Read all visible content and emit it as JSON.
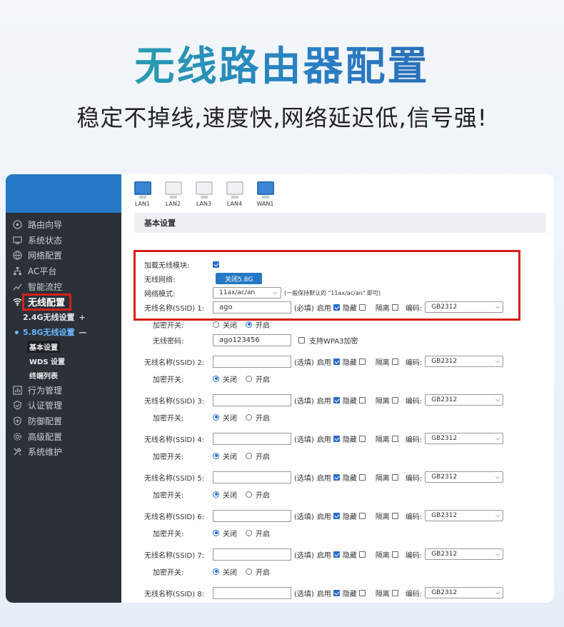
{
  "hero": {
    "title": "无线路由器配置",
    "subtitle": "稳定不掉线,速度快,网络延迟低,信号强!"
  },
  "ports": [
    {
      "label": "LAN1",
      "active": true
    },
    {
      "label": "LAN2",
      "active": false
    },
    {
      "label": "LAN3",
      "active": false
    },
    {
      "label": "LAN4",
      "active": false
    },
    {
      "label": "WAN1",
      "active": true
    }
  ],
  "sidebar": {
    "items_top": [
      {
        "label": "路由向导",
        "icon": "compass-icon"
      },
      {
        "label": "系统状态",
        "icon": "monitor-icon"
      },
      {
        "label": "网络配置",
        "icon": "globe-icon"
      },
      {
        "label": "AC平台",
        "icon": "network-tree-icon"
      },
      {
        "label": "智能流控",
        "icon": "trend-icon"
      }
    ],
    "active": {
      "label": "无线配置",
      "icon": "wifi-icon"
    },
    "sub": [
      {
        "label": "2.4G无线设置",
        "toggle": "+"
      },
      {
        "label": "5.8G无线设置",
        "toggle": "—"
      }
    ],
    "leaves": [
      "基本设置",
      "WDS 设置",
      "终端列表"
    ],
    "items_bottom": [
      {
        "label": "行为管理",
        "icon": "chart-icon"
      },
      {
        "label": "认证管理",
        "icon": "shield-check-icon"
      },
      {
        "label": "防御配置",
        "icon": "shield-plus-icon"
      },
      {
        "label": "高级配置",
        "icon": "gear-icon"
      },
      {
        "label": "系统维护",
        "icon": "tools-icon"
      }
    ]
  },
  "content": {
    "title": "基本设置",
    "load_module_label": "加载无线模块:",
    "wireless_label": "无线网络:",
    "wireless_button": "关闭5.8G",
    "mode_label": "网络模式:",
    "mode_value": "11ax/ac/an",
    "mode_hint": "(一般保持默认的 \"11ax/ac/an\" 即可)",
    "enc_switch_label": "加密开关:",
    "off_label": "关闭",
    "on_label": "开启",
    "password_label": "无线密码:",
    "password_value": "ago123456",
    "wpa3_label": "支持WPA3加密",
    "enable_label": "启用",
    "hidden_label": "隐藏",
    "isolate_label": "隔离",
    "encoding_label": "编码:",
    "encoding_value": "GB2312",
    "ssids": [
      {
        "label": "无线名称(SSID) 1:",
        "value": "ago",
        "req": "(必填)",
        "enc_on": true
      },
      {
        "label": "无线名称(SSID) 2:",
        "value": "",
        "req": "(选填)",
        "enc_on": false
      },
      {
        "label": "无线名称(SSID) 3:",
        "value": "",
        "req": "(选填)",
        "enc_on": false
      },
      {
        "label": "无线名称(SSID) 4:",
        "value": "",
        "req": "(选填)",
        "enc_on": false
      },
      {
        "label": "无线名称(SSID) 5:",
        "value": "",
        "req": "(选填)",
        "enc_on": false
      },
      {
        "label": "无线名称(SSID) 6:",
        "value": "",
        "req": "(选填)",
        "enc_on": false
      },
      {
        "label": "无线名称(SSID) 7:",
        "value": "",
        "req": "(选填)",
        "enc_on": false
      },
      {
        "label": "无线名称(SSID) 8:",
        "value": "",
        "req": "(选填)",
        "enc_on": false
      }
    ]
  }
}
